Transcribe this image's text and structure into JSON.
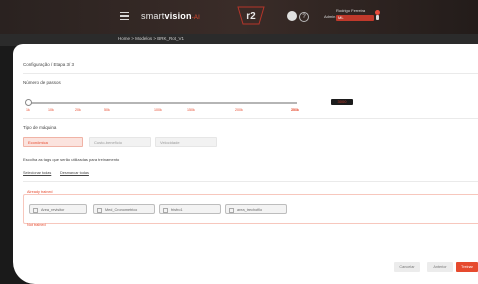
{
  "header": {
    "logo_prefix": "smart",
    "logo_main": "vision",
    "logo_suffix": "-AI",
    "badge": "r2",
    "help": "?",
    "user_label": "Admin",
    "user_name": "Rodrigo Ferreira",
    "user_role": "ML"
  },
  "breadcrumb": "Home  >  Modelos  >  BRK_Rot_V1",
  "config_title": "Configuração / Etapa 3/ 3",
  "steps": {
    "label": "Número de passos",
    "ticks": [
      "1k",
      "10k",
      "20k",
      "50k",
      "100k",
      "150k",
      "200k",
      "250k",
      "300k"
    ],
    "value": "3000",
    "level_fraction": 0.0
  },
  "machine": {
    "label": "Tipo de máquina",
    "options": [
      "Econômica",
      "Custo-benefício",
      "Velocidade"
    ],
    "selected": "Econômica"
  },
  "tags": {
    "label": "Escolha as tags que serão utilizadas para treinamento",
    "select_all": "Selecionar todas",
    "deselect_all": "Desmarcar todas",
    "already_trained": "Already trained",
    "not_trained": "Not trained",
    "items": [
      "Area_revisitor",
      "Med_Cronometrico",
      "frisfro1",
      "area_trechofilo"
    ]
  },
  "buttons": {
    "cancel": "Cancelar",
    "back": "Anterior",
    "next": "Treinar"
  },
  "colors": {
    "accent": "#e64a2e",
    "selected_bg": "#fbe3de"
  }
}
